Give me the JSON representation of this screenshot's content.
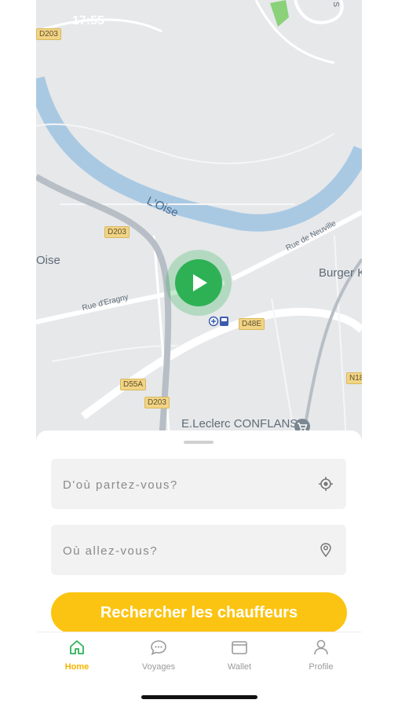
{
  "status_bar": {
    "time": "17:55"
  },
  "map": {
    "labels": {
      "river": "L'Oise",
      "oise_town": "Oise",
      "rue_de_neuville": "Rue de Neuville",
      "rue_eragny": "Rue d'Eragny",
      "burger": "Burger K",
      "leclerc": "E.Leclerc CONFLANS",
      "street_s": "S"
    },
    "road_badges": {
      "d203_top": "D203",
      "d203_mid": "D203",
      "d203_bottom": "D203",
      "d48e": "D48E",
      "d55a": "D55A",
      "n18": "N18"
    }
  },
  "search": {
    "from_placeholder": "D'où partez-vous?",
    "to_placeholder": "Où allez-vous?",
    "cta_label": "Rechercher les chauffeurs"
  },
  "tabs": [
    {
      "label": "Home",
      "icon": "home-icon",
      "active": true
    },
    {
      "label": "Voyages",
      "icon": "chat-icon",
      "active": false
    },
    {
      "label": "Wallet",
      "icon": "wallet-icon",
      "active": false
    },
    {
      "label": "Profile",
      "icon": "user-icon",
      "active": false
    }
  ],
  "colors": {
    "accent": "#fcc412",
    "active_tab": "#f5b400",
    "location": "#2eb155",
    "water": "#a9c9e3"
  }
}
